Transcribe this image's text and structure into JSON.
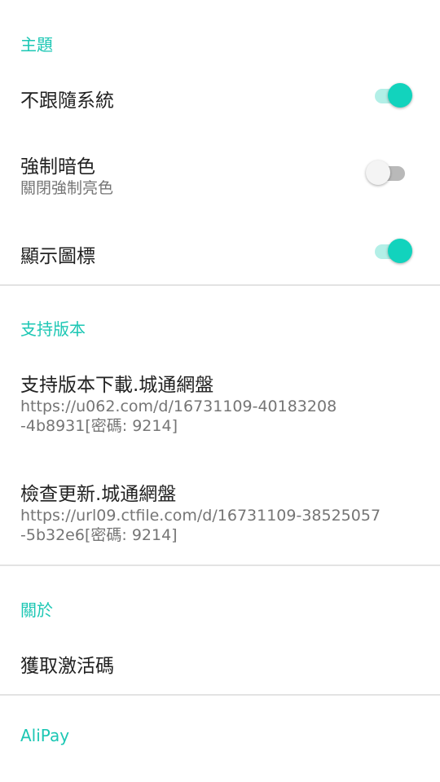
{
  "theme": {
    "header": "主題",
    "follow_system": {
      "title": "不跟隨系統",
      "enabled": true
    },
    "force_dark": {
      "title": "強制暗色",
      "summary": "關閉強制亮色",
      "enabled": false
    },
    "show_icon": {
      "title": "顯示圖標",
      "enabled": true
    }
  },
  "support": {
    "header": "支持版本",
    "download": {
      "title": "支持版本下載.城通網盤",
      "line1": "https://u062.com/d/16731109-40183208",
      "line2": "-4b8931[密碼: 9214]"
    },
    "update": {
      "title": "檢查更新.城通網盤",
      "line1": "https://url09.ctfile.com/d/16731109-38525057",
      "line2": "-5b32e6[密碼: 9214]"
    }
  },
  "about": {
    "header": "關於",
    "activation": {
      "title": "獲取激活碼"
    }
  },
  "alipay": {
    "header": "AliPay"
  },
  "colors": {
    "accent": "#1cc7b4",
    "switch_on_thumb": "#12d3bd",
    "switch_on_track": "#b3efe7",
    "switch_off_thumb": "#f4f4f4",
    "switch_off_track": "#b9b9b9",
    "divider": "#e3e3e3"
  }
}
